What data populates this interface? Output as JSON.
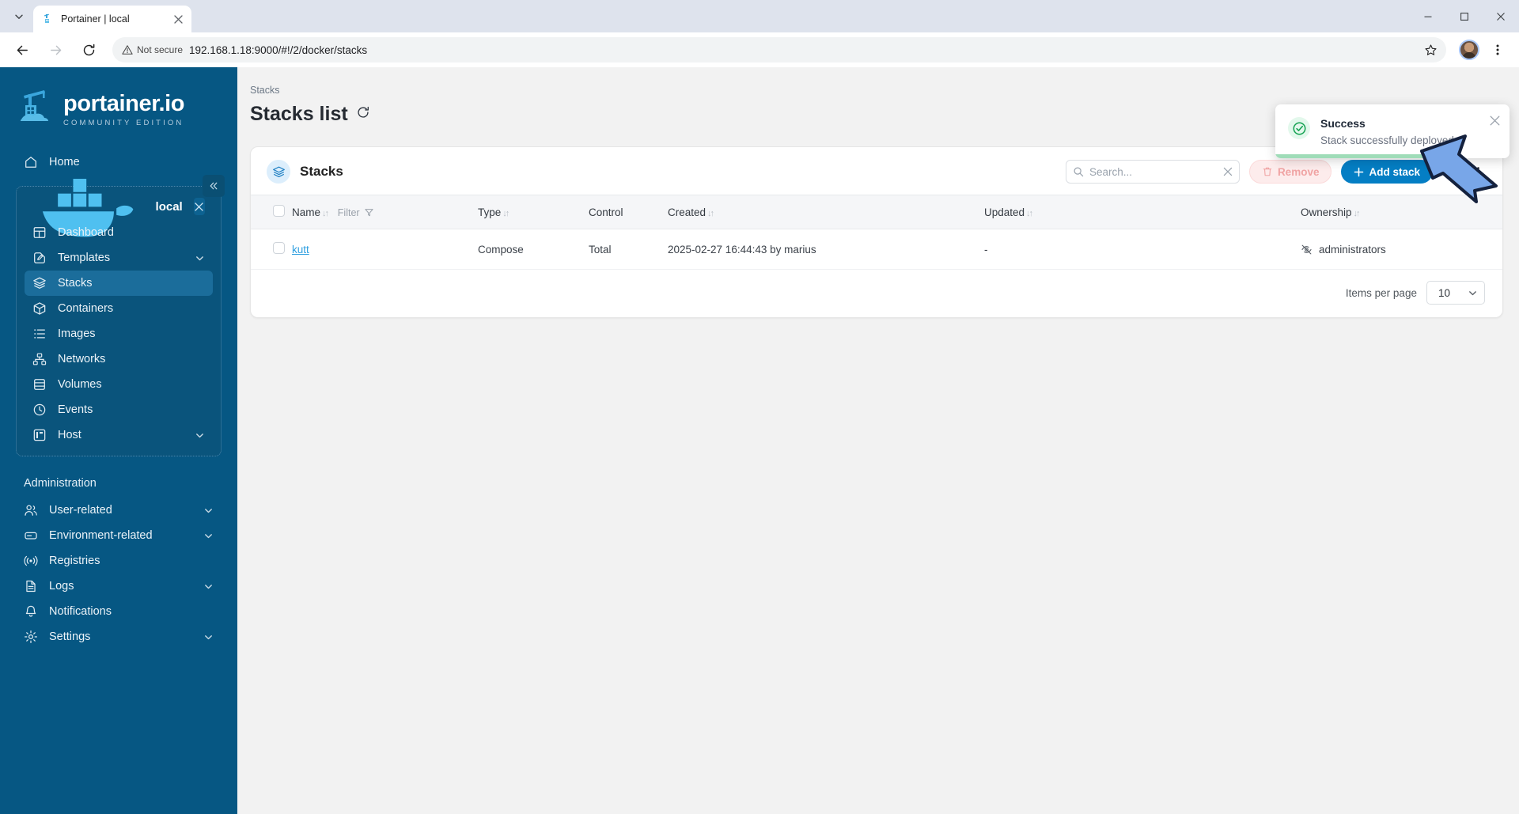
{
  "browser": {
    "tab": {
      "title": "Portainer | local",
      "favicon_icon": "portainer-favicon",
      "close_icon": "close-icon"
    },
    "tab_list_icon": "chevron-down-icon",
    "window": {
      "minimize_icon": "minimize-icon",
      "maximize_icon": "maximize-icon",
      "close_icon": "window-close-icon"
    },
    "nav": {
      "back_icon": "back-arrow-icon",
      "forward_icon": "forward-arrow-icon",
      "reload_icon": "reload-icon"
    },
    "omnibox": {
      "security_label": "Not secure",
      "security_icon": "warning-triangle-icon",
      "url": "192.168.1.18:9000/#!/2/docker/stacks",
      "star_icon": "bookmark-star-icon"
    },
    "profile_icon": "user-avatar",
    "menu_icon": "kebab-menu-icon"
  },
  "sidebar": {
    "logo": {
      "name": "portainer.io",
      "edition": "COMMUNITY EDITION",
      "icon": "portainer-crane-logo"
    },
    "collapse_icon": "double-chevron-left-icon",
    "home": {
      "label": "Home",
      "icon": "home-icon"
    },
    "environment": {
      "label": "local",
      "icon": "docker-whale-icon",
      "close_icon": "close-icon",
      "items": [
        {
          "label": "Dashboard",
          "icon": "dashboard-icon",
          "chevron": false,
          "active": false
        },
        {
          "label": "Templates",
          "icon": "templates-icon",
          "chevron": true,
          "active": false
        },
        {
          "label": "Stacks",
          "icon": "stacks-layers-icon",
          "chevron": false,
          "active": true
        },
        {
          "label": "Containers",
          "icon": "container-box-icon",
          "chevron": false,
          "active": false
        },
        {
          "label": "Images",
          "icon": "images-list-icon",
          "chevron": false,
          "active": false
        },
        {
          "label": "Networks",
          "icon": "networks-icon",
          "chevron": false,
          "active": false
        },
        {
          "label": "Volumes",
          "icon": "volumes-database-icon",
          "chevron": false,
          "active": false
        },
        {
          "label": "Events",
          "icon": "clock-icon",
          "chevron": false,
          "active": false
        },
        {
          "label": "Host",
          "icon": "host-server-icon",
          "chevron": true,
          "active": false
        }
      ]
    },
    "administration": {
      "title": "Administration",
      "items": [
        {
          "label": "User-related",
          "icon": "users-icon",
          "chevron": true
        },
        {
          "label": "Environment-related",
          "icon": "environment-icon",
          "chevron": true
        },
        {
          "label": "Registries",
          "icon": "registries-radio-icon",
          "chevron": false
        },
        {
          "label": "Logs",
          "icon": "document-logs-icon",
          "chevron": true
        },
        {
          "label": "Notifications",
          "icon": "bell-icon",
          "chevron": false
        },
        {
          "label": "Settings",
          "icon": "settings-gear-icon",
          "chevron": true
        }
      ]
    },
    "chevron_icon": "chevron-down-icon"
  },
  "main": {
    "breadcrumb": "Stacks",
    "page_title": "Stacks list",
    "refresh_icon": "refresh-icon",
    "card": {
      "title": "Stacks",
      "icon": "stacks-layers-icon",
      "search": {
        "placeholder": "Search...",
        "value": "",
        "icon": "search-icon",
        "clear_icon": "clear-x-icon"
      },
      "remove_button": {
        "label": "Remove",
        "icon": "trash-icon"
      },
      "add_button": {
        "label": "Add stack",
        "icon": "plus-icon"
      },
      "columns_icon": "columns-layout-icon",
      "more_icon": "kebab-menu-icon"
    },
    "table": {
      "columns": [
        {
          "label": "Name",
          "sortable": true,
          "filter": "Filter",
          "filter_icon": "funnel-icon"
        },
        {
          "label": "Type",
          "sortable": true
        },
        {
          "label": "Control",
          "sortable": false
        },
        {
          "label": "Created",
          "sortable": true
        },
        {
          "label": "Updated",
          "sortable": true
        },
        {
          "label": "Ownership",
          "sortable": true
        }
      ],
      "rows": [
        {
          "name": "kutt",
          "type": "Compose",
          "control": "Total",
          "created": "2025-02-27 16:44:43 by marius",
          "updated": "-",
          "ownership": "administrators",
          "ownership_icon": "eye-off-icon"
        }
      ]
    },
    "pagination": {
      "label": "Items per page",
      "value": "10",
      "chevron_icon": "chevron-down-icon"
    }
  },
  "toast": {
    "title": "Success",
    "message": "Stack successfully deployed",
    "icon": "check-circle-icon",
    "close_icon": "close-icon",
    "progress_percent": 70
  },
  "annotation": {
    "arrow_icon": "pointer-arrow-icon",
    "fill": "#78a6e8",
    "stroke": "#14213d"
  },
  "colors": {
    "sidebar": "#065783",
    "accent": "#047ec4",
    "page_bg": "#f2f2f2",
    "link": "#2e9fe0",
    "success": "#12a150"
  }
}
